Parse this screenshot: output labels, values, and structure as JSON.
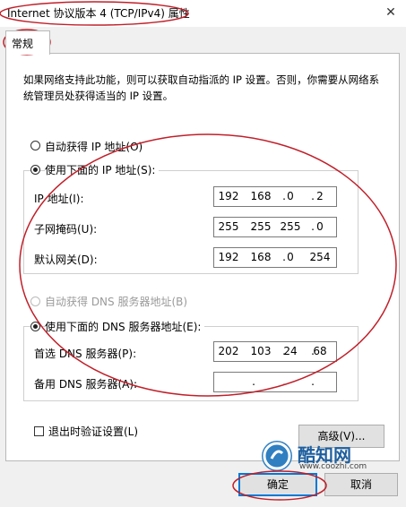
{
  "window": {
    "title": "Internet 协议版本 4 (TCP/IPv4) 属性",
    "close": "✕"
  },
  "tab": {
    "label": "常规"
  },
  "description": "如果网络支持此功能，则可以获取自动指派的 IP 设置。否则，你需要从网络系统管理员处获得适当的 IP 设置。",
  "ip_mode": {
    "auto_label": "自动获得 IP 地址(O)",
    "manual_label": "使用下面的 IP 地址(S):",
    "selected": "manual"
  },
  "ip_fields": [
    {
      "label": "IP 地址(I):",
      "octets": [
        "192",
        "168",
        "0",
        "2"
      ]
    },
    {
      "label": "子网掩码(U):",
      "octets": [
        "255",
        "255",
        "255",
        "0"
      ]
    },
    {
      "label": "默认网关(D):",
      "octets": [
        "192",
        "168",
        "0",
        "254"
      ]
    }
  ],
  "dns_mode": {
    "auto_label": "自动获得 DNS 服务器地址(B)",
    "manual_label": "使用下面的 DNS 服务器地址(E):",
    "selected": "manual",
    "auto_enabled": false
  },
  "dns_fields": [
    {
      "label": "首选 DNS 服务器(P):",
      "octets": [
        "202",
        "103",
        "24",
        "68"
      ]
    },
    {
      "label": "备用 DNS 服务器(A):",
      "octets": [
        "",
        "",
        "",
        ""
      ]
    }
  ],
  "validate": {
    "label": "退出时验证设置(L)",
    "checked": false
  },
  "buttons": {
    "advanced": "高级(V)...",
    "ok": "确定",
    "cancel": "取消"
  },
  "watermark": {
    "brand": "酷知网",
    "url": "www.coozhi.com"
  },
  "colors": {
    "annotation": "#c0202a",
    "focus": "#0078d7",
    "logo": "#2f7fc1"
  }
}
